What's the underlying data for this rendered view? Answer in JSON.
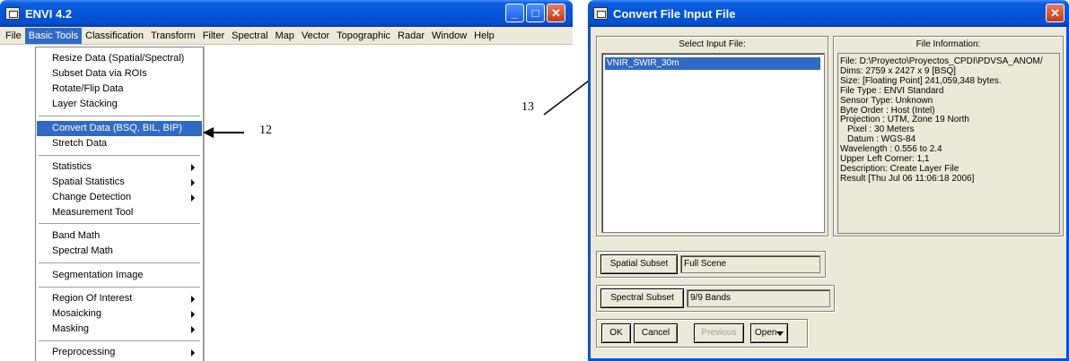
{
  "envi": {
    "title": "ENVI 4.2",
    "controls": {
      "minimize": "_",
      "maximize": "□",
      "close": "✕"
    },
    "menubar": [
      "File",
      "Basic Tools",
      "Classification",
      "Transform",
      "Filter",
      "Spectral",
      "Map",
      "Vector",
      "Topographic",
      "Radar",
      "Window",
      "Help"
    ],
    "active_menu": "Basic Tools",
    "dropdown": {
      "items": [
        "Resize Data (Spatial/Spectral)",
        "Subset Data via ROIs",
        "Rotate/Flip Data",
        "Layer Stacking",
        "Convert Data (BSQ, BIL, BIP)",
        "Stretch Data",
        "Statistics",
        "Spatial Statistics",
        "Change Detection",
        "Measurement Tool",
        "Band Math",
        "Spectral Math",
        "Segmentation Image",
        "Region Of Interest",
        "Mosaicking",
        "Masking",
        "Preprocessing"
      ],
      "highlighted": "Convert Data (BSQ, BIL, BIP)"
    }
  },
  "annotations": {
    "left_number": "12",
    "right_number": "13"
  },
  "dialog": {
    "title": "Convert File Input File",
    "close": "✕",
    "select_label": "Select Input File:",
    "files": [
      "VNIR_SWIR_30m"
    ],
    "info_label": "File Information:",
    "info_lines": [
      "File: D:\\Proyecto\\Proyectos_CPDI\\PDVSA_ANOM/",
      "Dims: 2759 x 2427 x 9 [BSQ]",
      "Size: [Floating Point] 241,059,348 bytes.",
      "File Type  : ENVI Standard",
      "Sensor Type: Unknown",
      "Byte Order : Host (Intel)",
      "Projection : UTM, Zone 19 North",
      "  Pixel    : 30 Meters",
      "  Datum    : WGS-84",
      "Wavelength : 0.556 to 2.4",
      "Upper Left Corner: 1,1",
      "Description: Create Layer File",
      "Result [Thu Jul 06 11:06:18 2006]"
    ],
    "spatial_subset_label": "Spatial Subset",
    "spatial_subset_value": "Full Scene",
    "spectral_subset_label": "Spectral Subset",
    "spectral_subset_value": "9/9 Bands",
    "ok": "OK",
    "cancel": "Cancel",
    "previous": "Previous",
    "open": "Open"
  }
}
